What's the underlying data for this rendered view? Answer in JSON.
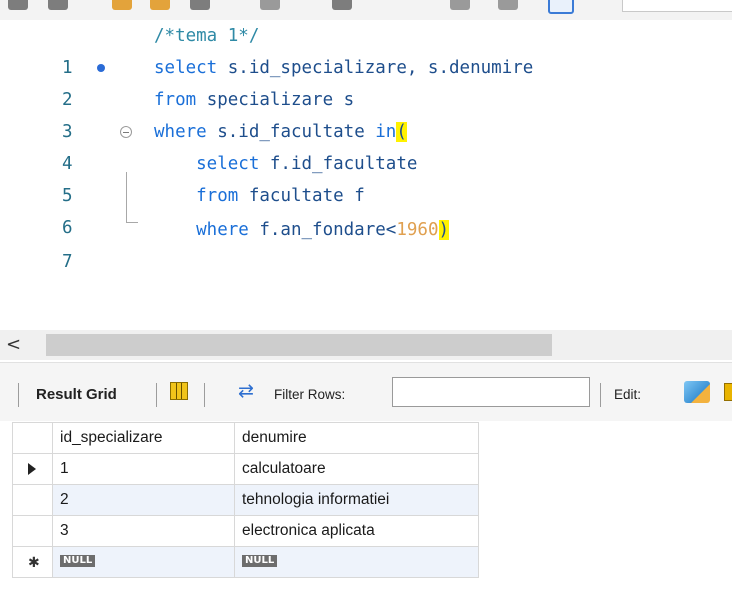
{
  "editor": {
    "lines": [
      {
        "num": "1",
        "parts": [
          {
            "cls": "comment",
            "text": "/*tema 1*/"
          }
        ]
      },
      {
        "num": "2",
        "parts": [
          {
            "cls": "kw",
            "text": "select"
          },
          {
            "cls": "id",
            "text": " s.id_specializare, s.denumire"
          }
        ]
      },
      {
        "num": "3",
        "parts": [
          {
            "cls": "kw",
            "text": "from"
          },
          {
            "cls": "id",
            "text": " specializare s"
          }
        ]
      },
      {
        "num": "4",
        "parts": [
          {
            "cls": "kw",
            "text": "where"
          },
          {
            "cls": "id",
            "text": " s.id_facultate "
          },
          {
            "cls": "kw",
            "text": "in"
          },
          {
            "cls": "hl",
            "text": "("
          }
        ]
      },
      {
        "num": "5",
        "parts": [
          {
            "cls": "kw",
            "text": "    select"
          },
          {
            "cls": "id",
            "text": " f.id_facultate"
          }
        ]
      },
      {
        "num": "6",
        "parts": [
          {
            "cls": "kw",
            "text": "    from"
          },
          {
            "cls": "id",
            "text": " facultate f"
          }
        ]
      },
      {
        "num": "7",
        "parts": [
          {
            "cls": "kw",
            "text": "    where"
          },
          {
            "cls": "id",
            "text": " f.an_fondare<"
          },
          {
            "cls": "num",
            "text": "1960"
          },
          {
            "cls": "hl",
            "text": ")"
          }
        ]
      }
    ]
  },
  "scrollbar": {
    "left_arrow": "<"
  },
  "result_toolbar": {
    "result_grid_label": "Result Grid",
    "filter_label": "Filter Rows:",
    "filter_value": "",
    "edit_label": "Edit:"
  },
  "grid": {
    "columns": [
      "id_specializare",
      "denumire"
    ],
    "rows": [
      [
        "1",
        "calculatoare"
      ],
      [
        "2",
        "tehnologia informatiei"
      ],
      [
        "3",
        "electronica aplicata"
      ]
    ],
    "null_label": "NULL"
  },
  "colors": {
    "keyword": "#1a6fd8",
    "identifier": "#1e4e8c",
    "comment": "#2f8aa6",
    "number": "#e0a050",
    "bracket_highlight": "#fff200",
    "alt_row": "#eef3fb"
  },
  "icons": [
    "result-grid-icon",
    "filter-rows-icon",
    "edit-pencil-icon"
  ]
}
